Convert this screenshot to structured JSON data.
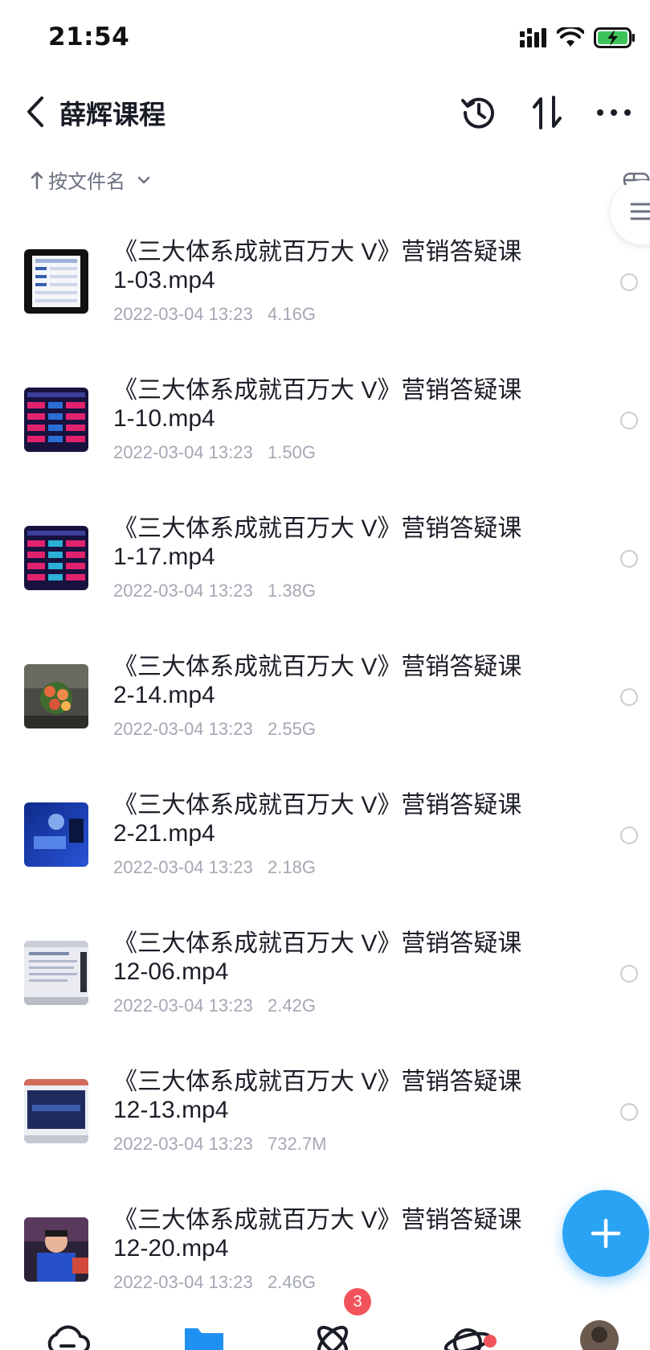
{
  "status_bar": {
    "time": "21:54"
  },
  "header": {
    "title": "薛辉课程",
    "icons": [
      "back-chevron-icon",
      "history-icon",
      "sort-arrows-icon",
      "more-icon"
    ]
  },
  "sort": {
    "label": "按文件名"
  },
  "files": [
    {
      "name": "《三大体系成就百万大 V》营销答疑课 1-03.mp4",
      "date": "2022-03-04 13:23",
      "size": "4.16G"
    },
    {
      "name": "《三大体系成就百万大 V》营销答疑课 1-10.mp4",
      "date": "2022-03-04 13:23",
      "size": "1.50G"
    },
    {
      "name": "《三大体系成就百万大 V》营销答疑课 1-17.mp4",
      "date": "2022-03-04 13:23",
      "size": "1.38G"
    },
    {
      "name": "《三大体系成就百万大 V》营销答疑课 2-14.mp4",
      "date": "2022-03-04 13:23",
      "size": "2.55G"
    },
    {
      "name": "《三大体系成就百万大 V》营销答疑课 2-21.mp4",
      "date": "2022-03-04 13:23",
      "size": "2.18G"
    },
    {
      "name": "《三大体系成就百万大 V》营销答疑课 12-06.mp4",
      "date": "2022-03-04 13:23",
      "size": "2.42G"
    },
    {
      "name": "《三大体系成就百万大 V》营销答疑课 12-13.mp4",
      "date": "2022-03-04 13:23",
      "size": "732.7M"
    },
    {
      "name": "《三大体系成就百万大 V》营销答疑课 12-20.mp4",
      "date": "2022-03-04 13:23",
      "size": "2.46G"
    }
  ],
  "bottom_nav": {
    "badge_count": "3"
  },
  "colors": {
    "accent": "#2aa3f5",
    "badge": "#f2535a",
    "meta_text": "#a4a8b4"
  }
}
